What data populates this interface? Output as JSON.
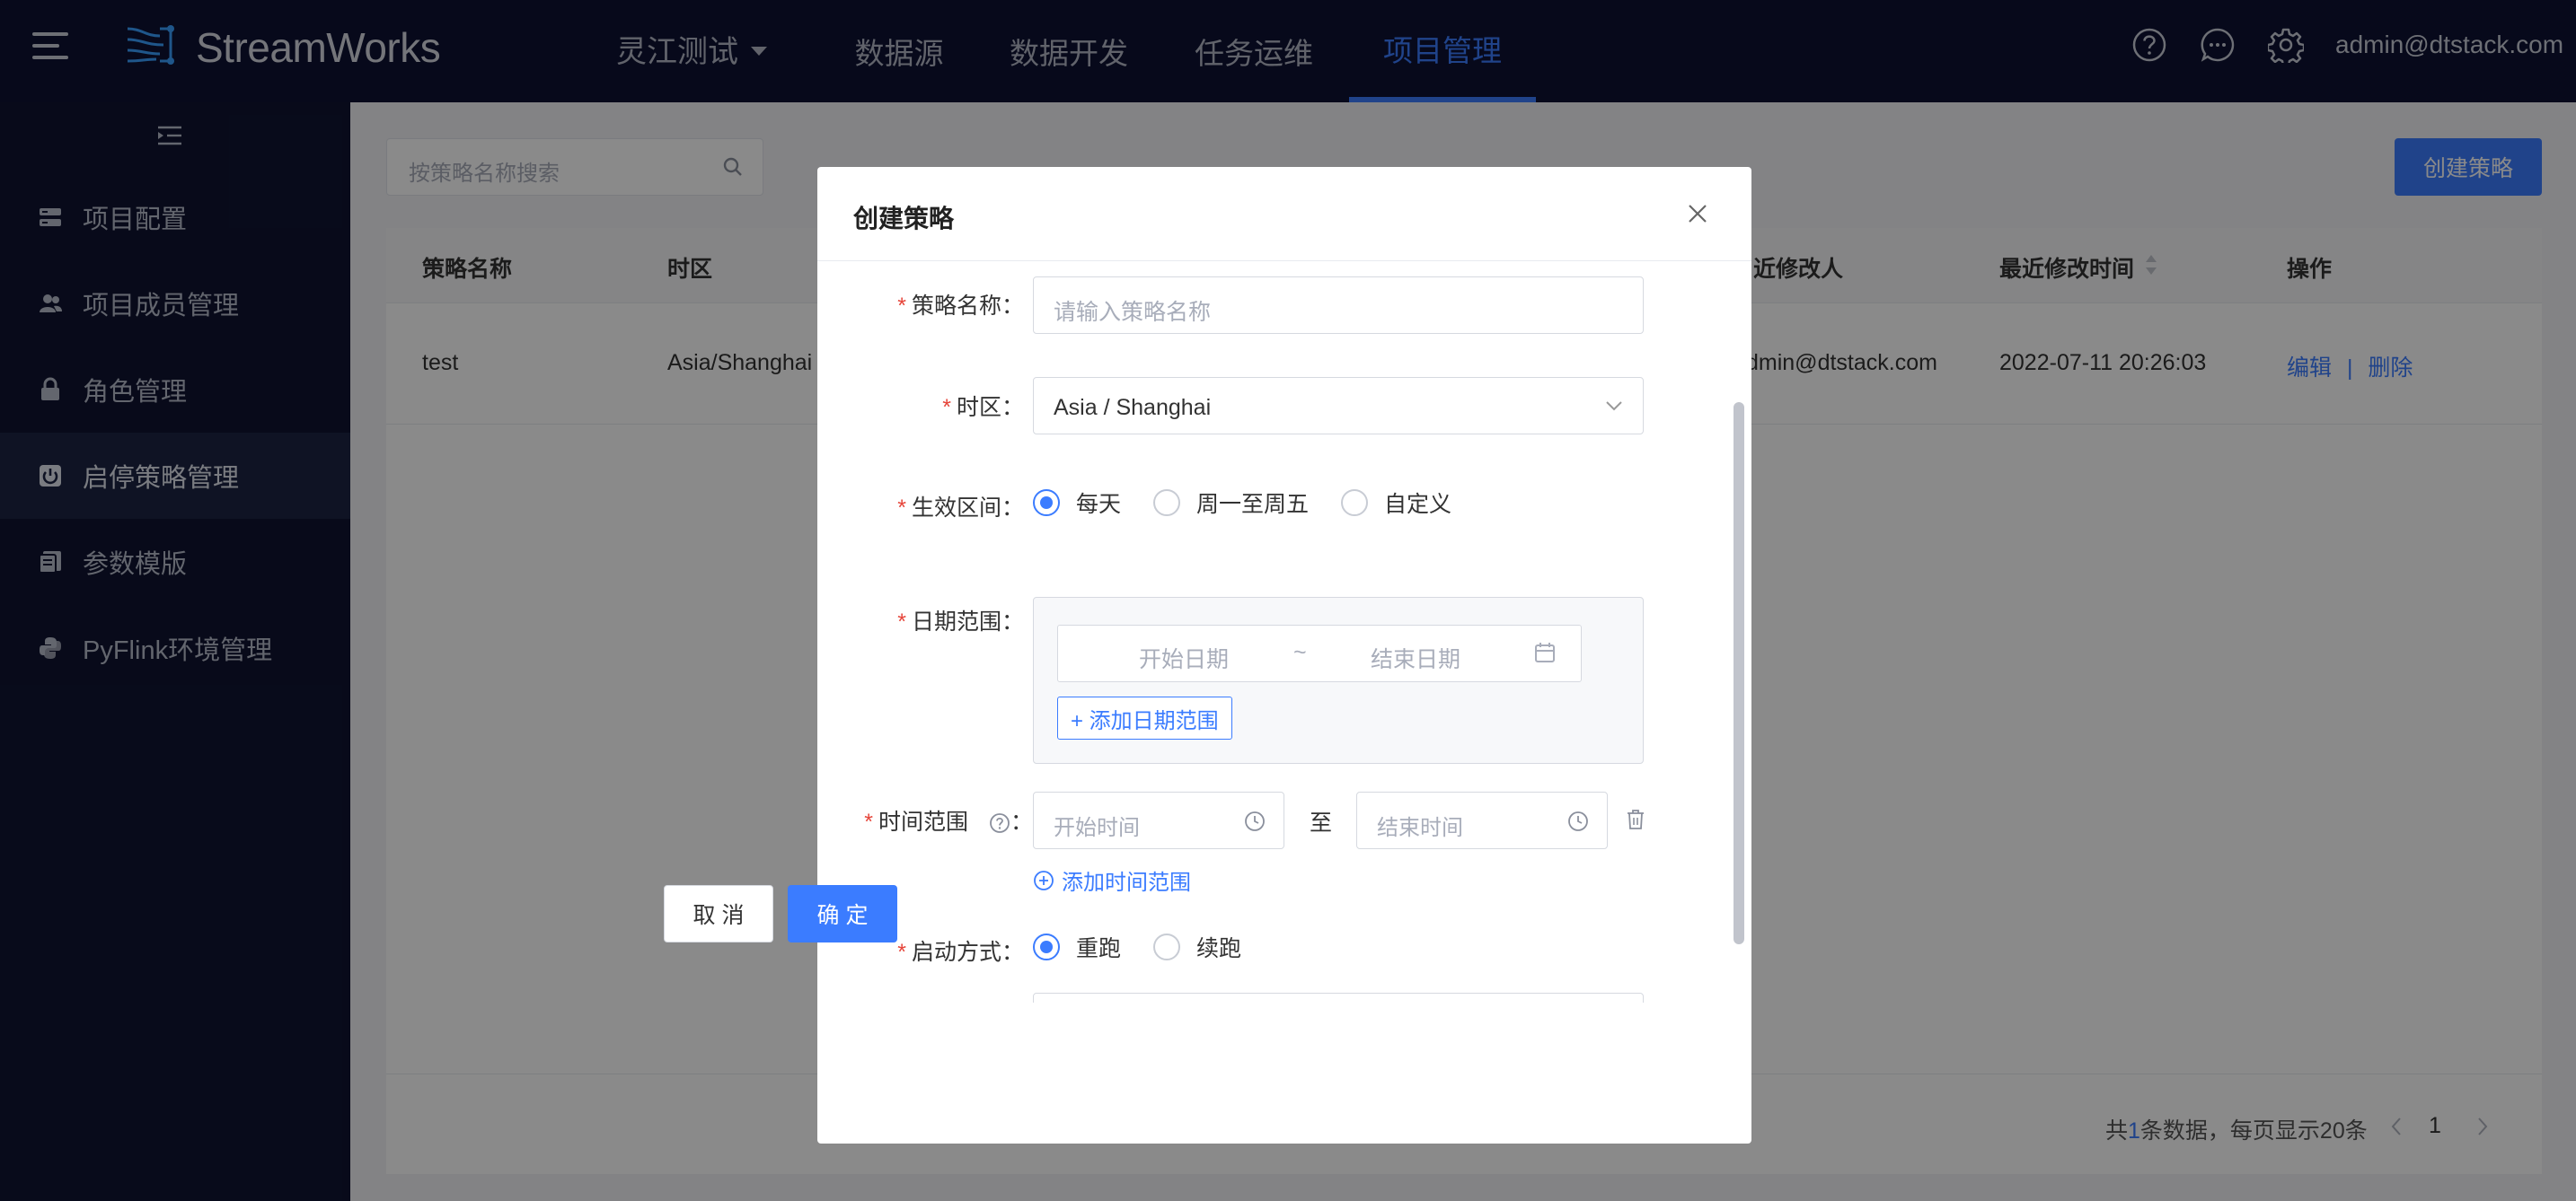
{
  "app": {
    "brand": "StreamWorks",
    "tenant": "灵江测试",
    "user": "admin@dtstack.com"
  },
  "nav": [
    "数据源",
    "数据开发",
    "任务运维",
    "项目管理"
  ],
  "nav_active": "项目管理",
  "sidebar": {
    "items": [
      {
        "label": "项目配置",
        "icon": "settings-list-icon"
      },
      {
        "label": "项目成员管理",
        "icon": "users-icon"
      },
      {
        "label": "角色管理",
        "icon": "lock-icon"
      },
      {
        "label": "启停策略管理",
        "icon": "power-icon",
        "active": true
      },
      {
        "label": "参数模版",
        "icon": "document-icon"
      },
      {
        "label": "PyFlink环境管理",
        "icon": "python-icon"
      }
    ]
  },
  "page": {
    "search_placeholder": "按策略名称搜索",
    "create_button": "创建策略",
    "table": {
      "headers": [
        "策略名称",
        "时区",
        "近修改人",
        "最近修改时间",
        "操作"
      ],
      "rows": [
        {
          "name": "test",
          "timezone": "Asia/Shanghai",
          "modifier": "dmin@dtstack.com",
          "modified_at": "2022-07-11 20:26:03",
          "edit": "编辑",
          "sep": "|",
          "delete": "删除"
        }
      ]
    },
    "pagination": {
      "prefix": "共",
      "total": "1",
      "suffix": "条数据，每页显示20条",
      "current": "1"
    }
  },
  "modal": {
    "title": "创建策略",
    "fields": {
      "name": {
        "label": "策略名称",
        "placeholder": "请输入策略名称"
      },
      "timezone": {
        "label": "时区",
        "value": "Asia / Shanghai"
      },
      "period": {
        "label": "生效区间",
        "options": [
          "每天",
          "周一至周五",
          "自定义"
        ],
        "selected": "每天"
      },
      "date_range": {
        "label": "日期范围",
        "start_placeholder": "开始日期",
        "separator": "~",
        "end_placeholder": "结束日期",
        "add_label": "+ 添加日期范围"
      },
      "time_range": {
        "label": "时间范围",
        "start_placeholder": "开始时间",
        "to": "至",
        "end_placeholder": "结束时间",
        "add_label": "添加时间范围"
      },
      "start_mode": {
        "label": "启动方式",
        "options": [
          "重跑",
          "续跑"
        ],
        "selected": "重跑"
      }
    },
    "cancel": "取 消",
    "ok": "确 定"
  },
  "colors": {
    "primary": "#3b7cff",
    "topbar": "#0d1233",
    "sidebar": "#0f1431",
    "required": "#e6453a"
  }
}
